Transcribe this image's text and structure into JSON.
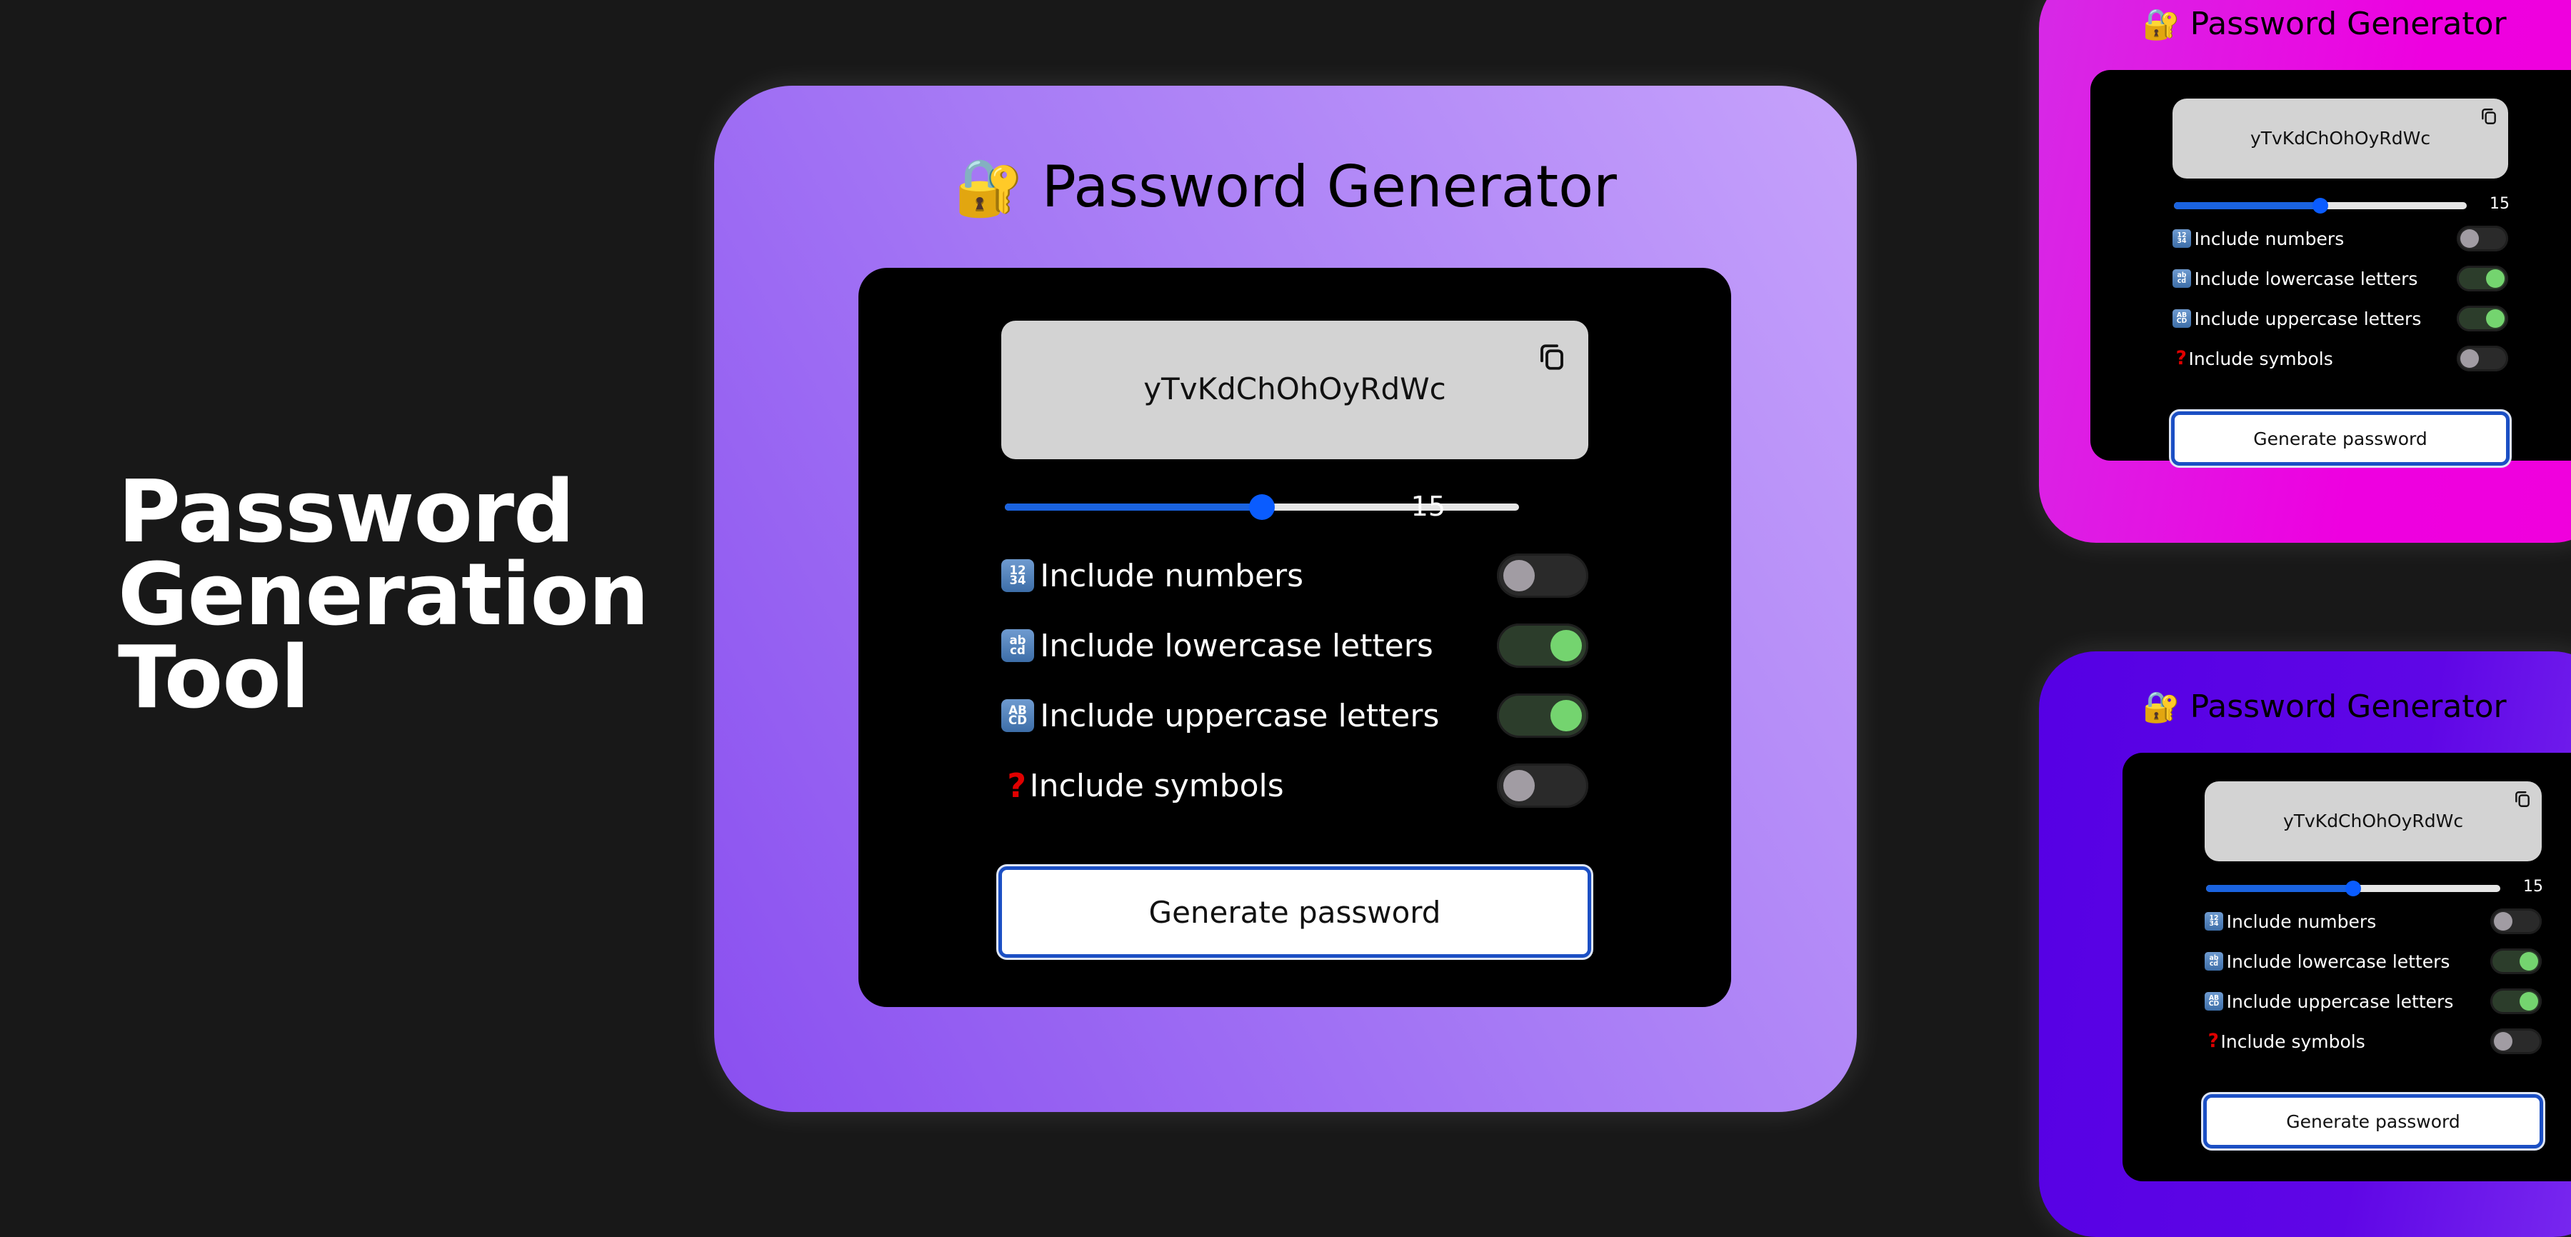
{
  "hero": {
    "lines": [
      "Password",
      "Generation",
      "Tool"
    ]
  },
  "app": {
    "title_emoji": "🔐",
    "title": "Password Generator",
    "password": "yTvKdChOhOyRdWc",
    "copy_icon": "copy-icon",
    "length": {
      "value": "15",
      "fraction": 0.5
    },
    "options": [
      {
        "badge": [
          "12",
          "34"
        ],
        "icon": "numbers-icon",
        "label": "Include numbers",
        "enabled": false
      },
      {
        "badge": [
          "ab",
          "cd"
        ],
        "icon": "lowercase-icon",
        "label": "Include lowercase letters",
        "enabled": true
      },
      {
        "badge": [
          "AB",
          "CD"
        ],
        "icon": "uppercase-icon",
        "label": "Include uppercase letters",
        "enabled": true
      },
      {
        "badge": null,
        "icon": "question-mark-icon",
        "symbol": "?",
        "label": "Include symbols",
        "enabled": false
      }
    ],
    "generate_label": "Generate password"
  },
  "themes": {
    "main": "#9b6af3",
    "top": "#ee00e0",
    "bottom": "#5a00e6",
    "toggle_on": "#74d46f",
    "slider": "#0a5cff"
  }
}
